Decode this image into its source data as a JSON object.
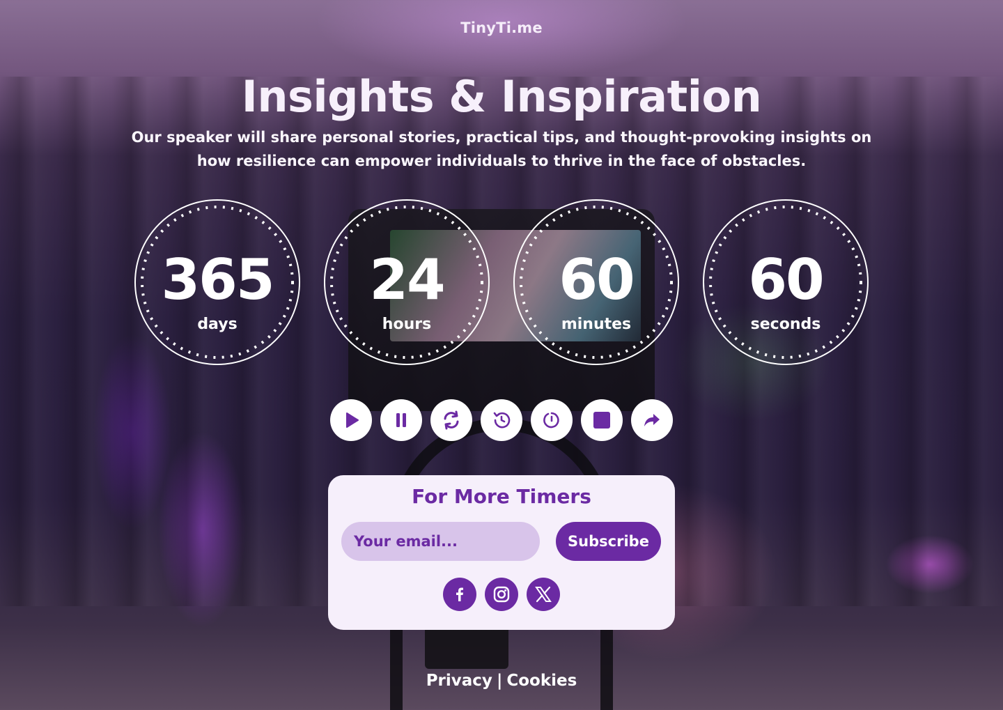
{
  "brand": "TinyTi.me",
  "hero": {
    "title": "Insights & Inspiration",
    "subtitle": "Our speaker will share personal stories, practical tips, and thought-provoking insights on how resilience can empower individuals to thrive in the face of obstacles."
  },
  "timers": [
    {
      "value": "365",
      "label": "days"
    },
    {
      "value": "24",
      "label": "hours"
    },
    {
      "value": "60",
      "label": "minutes"
    },
    {
      "value": "60",
      "label": "seconds"
    }
  ],
  "controls": [
    {
      "icon": "play-icon"
    },
    {
      "icon": "pause-icon"
    },
    {
      "icon": "refresh-icon"
    },
    {
      "icon": "history-icon"
    },
    {
      "icon": "timer-reset-icon"
    },
    {
      "icon": "stop-icon"
    },
    {
      "icon": "share-icon"
    }
  ],
  "subscribe_card": {
    "title": "For More Timers",
    "email_placeholder": "Your email...",
    "button_label": "Subscribe",
    "socials": [
      {
        "icon": "facebook-icon"
      },
      {
        "icon": "instagram-icon"
      },
      {
        "icon": "x-icon"
      }
    ]
  },
  "footer": {
    "privacy": "Privacy",
    "separator": "|",
    "cookies": "Cookies"
  },
  "colors": {
    "accent": "#6b2aa3",
    "card_bg": "#f6effb",
    "input_bg": "#d8c4ea"
  }
}
